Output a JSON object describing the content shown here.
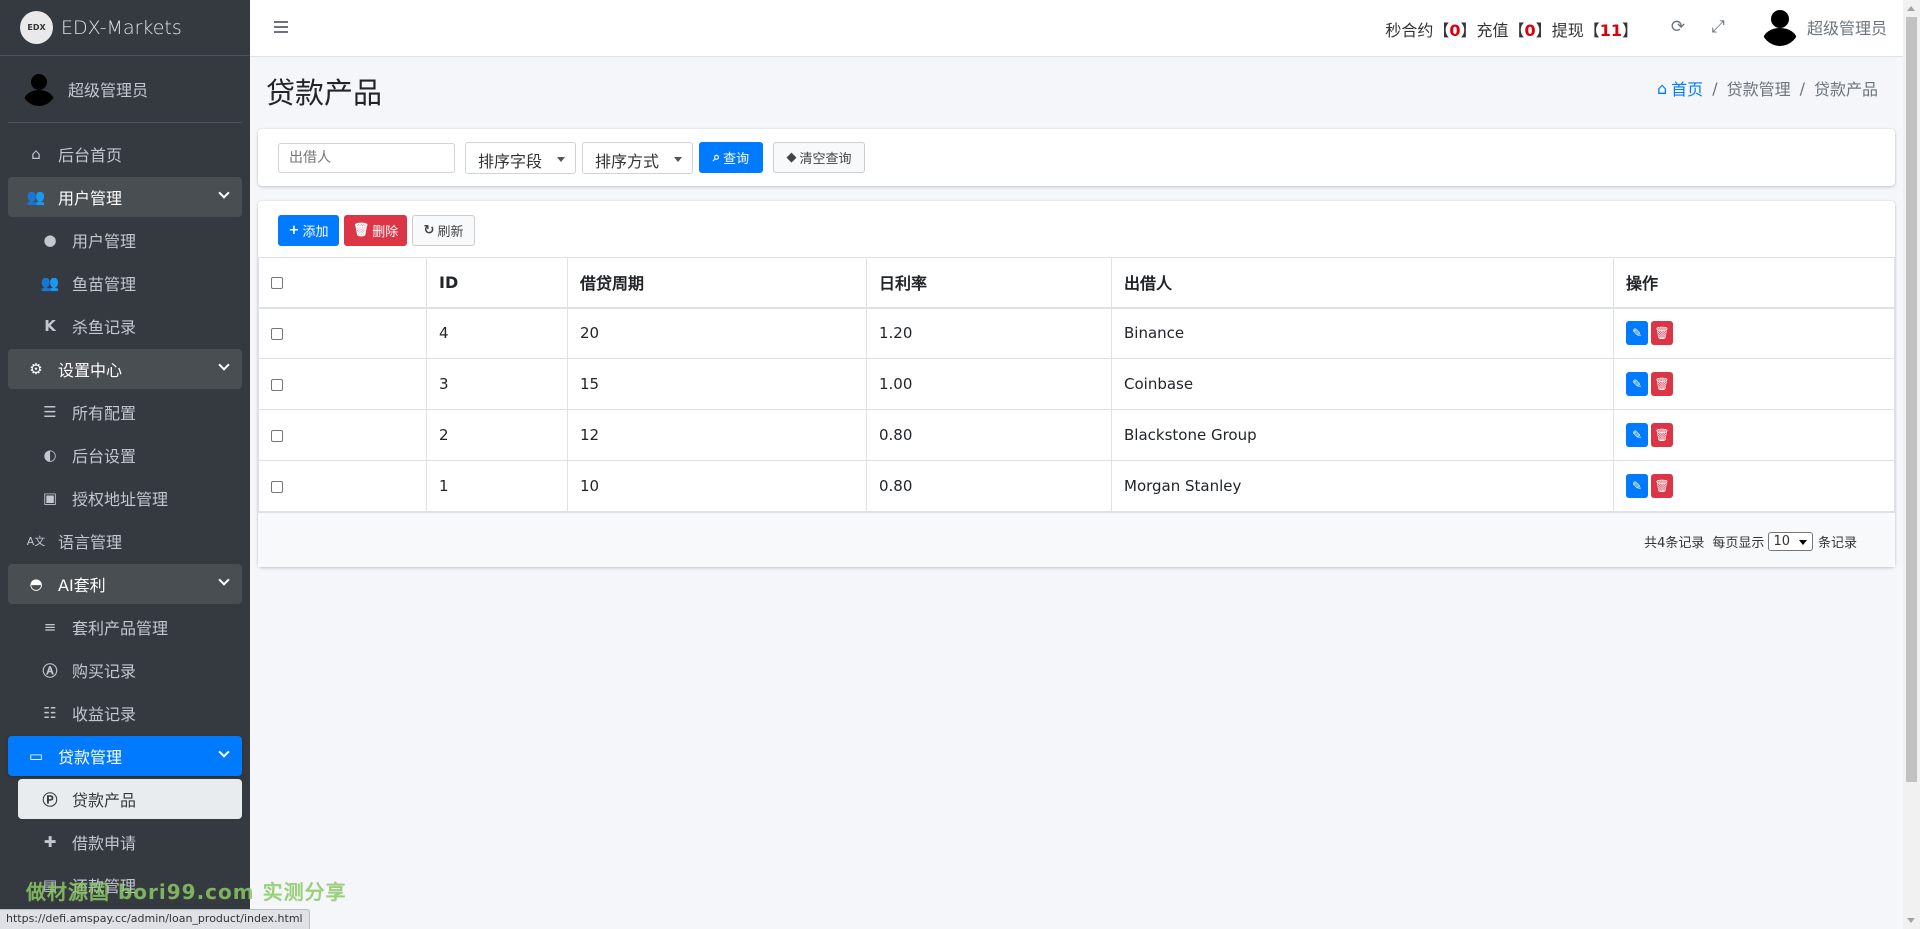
{
  "brand": {
    "logo_text": "EDX",
    "name": "EDX-Markets"
  },
  "user_panel": {
    "name": "超级管理员"
  },
  "sidebar": {
    "items": [
      {
        "label": "后台首页",
        "icon": "home-icon"
      },
      {
        "label": "用户管理",
        "icon": "users-icon",
        "expandable": true
      },
      {
        "label": "用户管理",
        "icon": "user-icon"
      },
      {
        "label": "鱼苗管理",
        "icon": "users-icon"
      },
      {
        "label": "杀鱼记录",
        "icon": "k-icon"
      },
      {
        "label": "设置中心",
        "icon": "cogs-icon",
        "expandable": true
      },
      {
        "label": "所有配置",
        "icon": "list-icon"
      },
      {
        "label": "后台设置",
        "icon": "adjust-icon"
      },
      {
        "label": "授权地址管理",
        "icon": "address-book-icon"
      },
      {
        "label": "语言管理",
        "icon": "language-icon"
      },
      {
        "label": "AI套利",
        "icon": "android-icon",
        "expandable": true
      },
      {
        "label": "套利产品管理",
        "icon": "bars-icon"
      },
      {
        "label": "购买记录",
        "icon": "font-icon"
      },
      {
        "label": "收益记录",
        "icon": "tasks-icon"
      },
      {
        "label": "贷款管理",
        "icon": "money-bill-icon",
        "expandable": true
      },
      {
        "label": "贷款产品",
        "icon": "parking-icon"
      },
      {
        "label": "借款申请",
        "icon": "ambulance-icon"
      },
      {
        "label": "还款管理",
        "icon": "file-icon"
      }
    ]
  },
  "header": {
    "stats": {
      "miaoheyue_label": "秒合约",
      "miaoheyue": "0",
      "chongzhi_label": "充值",
      "chongzhi": "0",
      "tixian_label": "提现",
      "tixian": "11"
    },
    "user_name": "超级管理员"
  },
  "page": {
    "title": "贷款产品"
  },
  "breadcrumb": {
    "home": "首页",
    "level1": "贷款管理",
    "level2": "贷款产品"
  },
  "search": {
    "lender_placeholder": "出借人",
    "sort_field": "排序字段",
    "sort_order": "排序方式",
    "query_button": "查询",
    "clear_button": "清空查询"
  },
  "toolbar": {
    "add": "添加",
    "delete": "删除",
    "refresh": "刷新"
  },
  "table": {
    "columns": [
      "ID",
      "借贷周期",
      "日利率",
      "出借人",
      "操作"
    ],
    "rows": [
      {
        "id": "4",
        "period": "20",
        "rate": "1.20",
        "lender": "Binance"
      },
      {
        "id": "3",
        "period": "15",
        "rate": "1.00",
        "lender": "Coinbase"
      },
      {
        "id": "2",
        "period": "12",
        "rate": "0.80",
        "lender": "Blackstone Group"
      },
      {
        "id": "1",
        "period": "10",
        "rate": "0.80",
        "lender": "Morgan Stanley"
      }
    ]
  },
  "footer": {
    "total": "共4条记录",
    "per_page_label": "每页显示",
    "per_page": "10",
    "unit": "条记录"
  },
  "watermark": "做材源国 bori99.com 实测分享",
  "statusbar": "https://defi.amspay.cc/admin/loan_product/index.html",
  "colors": {
    "primary": "#007bff",
    "danger": "#dc3545",
    "sidebar": "#343a40",
    "stat_highlight": "#d9000f"
  }
}
